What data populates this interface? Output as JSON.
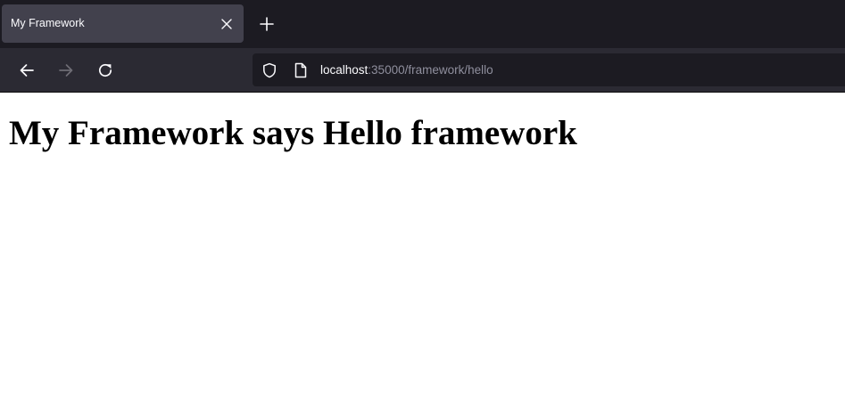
{
  "browser": {
    "tab": {
      "title": "My Framework"
    },
    "address_bar": {
      "host": "localhost",
      "rest": ":35000/framework/hello"
    },
    "icons": {
      "close": "close-icon",
      "new_tab": "plus-icon",
      "back": "arrow-left-icon",
      "forward": "arrow-right-icon",
      "reload": "reload-icon",
      "tracking": "shield-icon",
      "page": "page-icon"
    },
    "colors": {
      "tabbar_bg": "#1c1b22",
      "active_tab_bg": "#42414d",
      "toolbar_bg": "#2b2a33",
      "url_muted": "#8f8f9d"
    }
  },
  "page": {
    "heading": "My Framework says Hello framework"
  }
}
